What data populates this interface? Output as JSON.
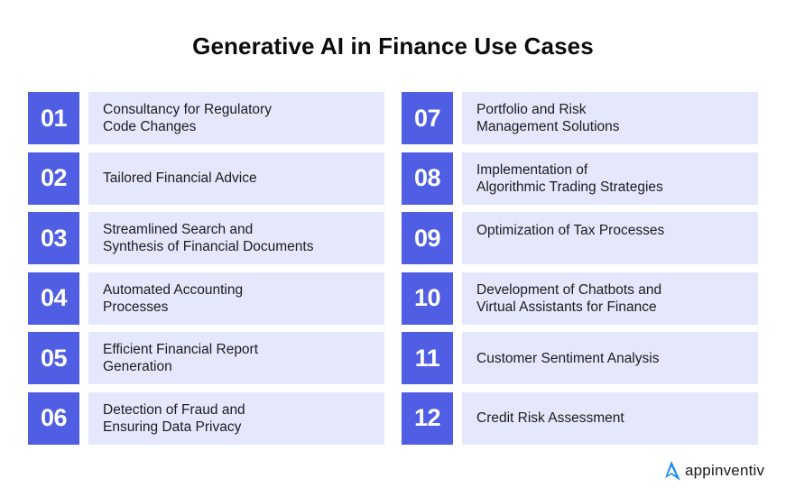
{
  "title": "Generative AI in Finance Use Cases",
  "colors": {
    "number_box": "#4f5ee3",
    "text_box": "#e5e8fc",
    "brand_logo": "#1a8cf0"
  },
  "items": [
    {
      "number": "01",
      "lines": [
        "Consultancy for Regulatory",
        "Code Changes"
      ]
    },
    {
      "number": "02",
      "lines": [
        "Tailored Financial Advice"
      ]
    },
    {
      "number": "03",
      "lines": [
        "Streamlined Search and",
        "Synthesis of Financial Documents"
      ]
    },
    {
      "number": "04",
      "lines": [
        "Automated Accounting",
        "Processes"
      ]
    },
    {
      "number": "05",
      "lines": [
        "Efficient Financial Report",
        "Generation"
      ]
    },
    {
      "number": "06",
      "lines": [
        "Detection of Fraud and",
        "Ensuring Data Privacy"
      ]
    },
    {
      "number": "07",
      "lines": [
        "Portfolio and Risk",
        "Management Solutions"
      ]
    },
    {
      "number": "08",
      "lines": [
        "Implementation of",
        "Algorithmic Trading Strategies"
      ]
    },
    {
      "number": "09",
      "lines": [
        "Optimization of Tax Processes"
      ]
    },
    {
      "number": "10",
      "lines": [
        "Development of Chatbots and",
        "Virtual Assistants for Finance"
      ]
    },
    {
      "number": "11",
      "lines": [
        "Customer Sentiment Analysis"
      ]
    },
    {
      "number": "12",
      "lines": [
        "Credit Risk Assessment"
      ]
    }
  ],
  "brand": {
    "icon": "appinventiv-logo-icon",
    "name": "appinventiv"
  }
}
